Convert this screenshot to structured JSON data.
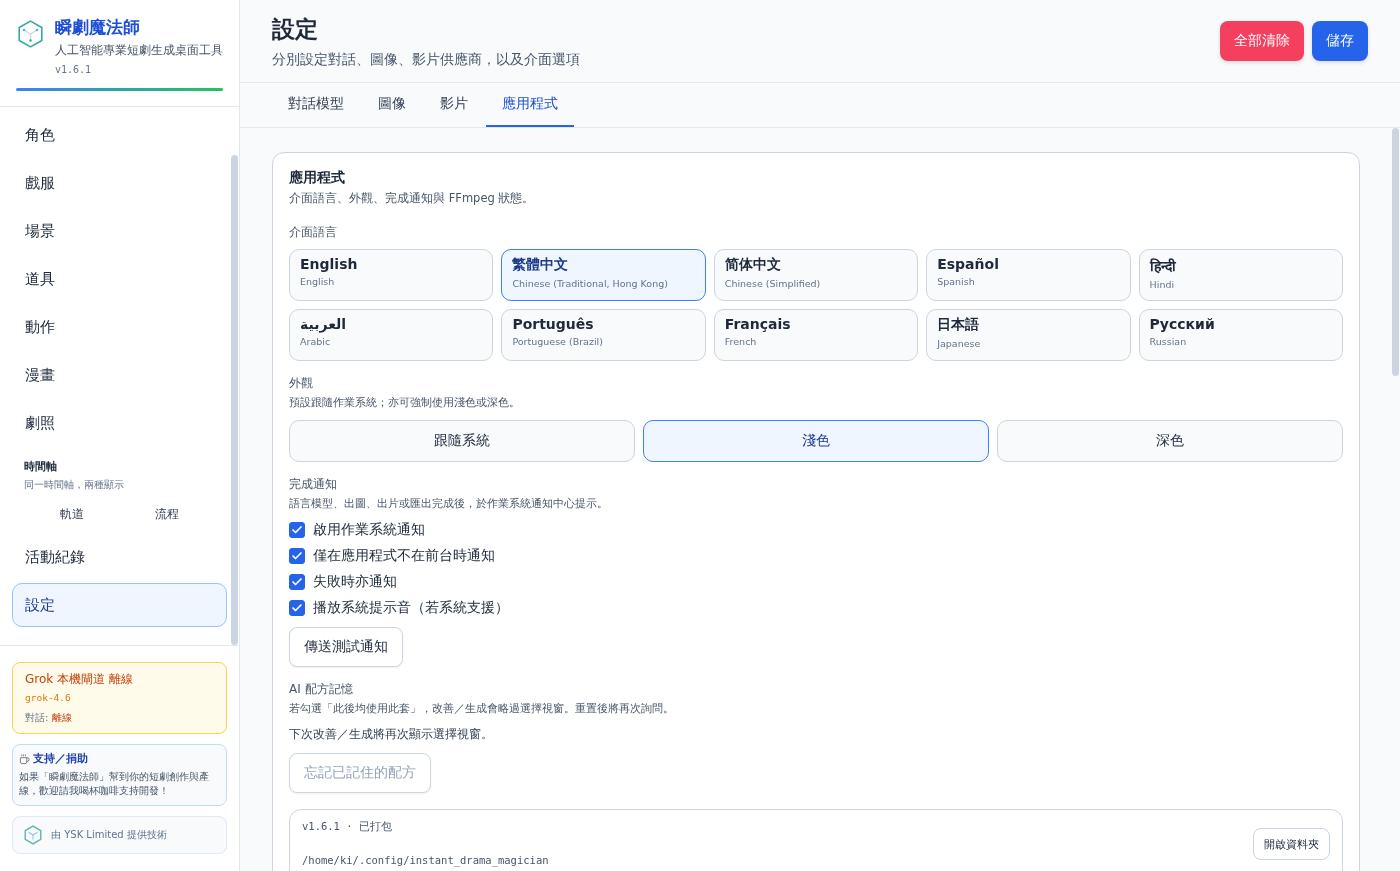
{
  "app": {
    "name": "瞬劇魔法師",
    "tagline": "人工智能專業短劇生成桌面工具",
    "version": "v1.6.1"
  },
  "nav": [
    {
      "kind": "link",
      "label": "角色",
      "selected": false
    },
    {
      "kind": "link",
      "label": "戲服",
      "selected": false
    },
    {
      "kind": "link",
      "label": "場景",
      "selected": false
    },
    {
      "kind": "link",
      "label": "道具",
      "selected": false
    },
    {
      "kind": "link",
      "label": "動作",
      "selected": false
    },
    {
      "kind": "link",
      "label": "漫畫",
      "selected": false
    },
    {
      "kind": "link",
      "label": "劇照",
      "selected": false
    },
    {
      "kind": "group",
      "title": "時間軸",
      "subtitle": "同一時間軸，兩種顯示",
      "children": [
        {
          "label": "軌道",
          "selected": false
        },
        {
          "label": "流程",
          "selected": false
        }
      ]
    },
    {
      "kind": "link",
      "label": "活動紀錄",
      "selected": false
    },
    {
      "kind": "link",
      "label": "設定",
      "selected": true
    }
  ],
  "status_card": {
    "title": "Grok 本機閘道 離線",
    "model": "grok-4.6",
    "label": "對話:",
    "value": "離線"
  },
  "support": {
    "title": "支持／捐助",
    "text": "如果「瞬劇魔法師」幫到你的短劇創作與產線，歡迎請我喝杯咖啡支持開發！"
  },
  "credit": "由 YSK Limited 提供技術",
  "header": {
    "title": "設定",
    "subtitle": "分別設定對話、圖像、影片供應商，以及介面選項"
  },
  "actions": [
    {
      "label": "全部清除",
      "kind": "danger"
    },
    {
      "label": "儲存",
      "kind": "primary"
    }
  ],
  "tabs": [
    {
      "label": "對話模型",
      "selected": false
    },
    {
      "label": "圖像",
      "selected": false
    },
    {
      "label": "影片",
      "selected": false
    },
    {
      "label": "應用程式",
      "selected": true
    }
  ],
  "section": {
    "title": "應用程式",
    "subtitle": "介面語言、外觀、完成通知與 FFmpeg 狀態。",
    "language": {
      "label": "介面語言",
      "options": [
        {
          "name": "English",
          "sub": "English",
          "selected": false
        },
        {
          "name": "繁體中文",
          "sub": "Chinese (Traditional, Hong Kong)",
          "selected": true
        },
        {
          "name": "简体中文",
          "sub": "Chinese (Simplified)",
          "selected": false
        },
        {
          "name": "Español",
          "sub": "Spanish",
          "selected": false
        },
        {
          "name": "हिन्दी",
          "sub": "Hindi",
          "selected": false
        },
        {
          "name": "العربية",
          "sub": "Arabic",
          "selected": false
        },
        {
          "name": "Português",
          "sub": "Portuguese (Brazil)",
          "selected": false
        },
        {
          "name": "Français",
          "sub": "French",
          "selected": false
        },
        {
          "name": "日本語",
          "sub": "Japanese",
          "selected": false
        },
        {
          "name": "Русский",
          "sub": "Russian",
          "selected": false
        }
      ]
    },
    "appearance": {
      "label": "外觀",
      "hint": "預設跟隨作業系統；亦可強制使用淺色或深色。",
      "options": [
        {
          "label": "跟隨系統",
          "selected": false
        },
        {
          "label": "淺色",
          "selected": true
        },
        {
          "label": "深色",
          "selected": false
        }
      ]
    },
    "notifications": {
      "label": "完成通知",
      "hint": "語言模型、出圖、出片或匯出完成後，於作業系統通知中心提示。",
      "options": [
        {
          "label": "啟用作業系統通知",
          "checked": true
        },
        {
          "label": "僅在應用程式不在前台時通知",
          "checked": true
        },
        {
          "label": "失敗時亦通知",
          "checked": true
        },
        {
          "label": "播放系統提示音（若系統支援）",
          "checked": true
        }
      ],
      "button": "傳送測試通知"
    },
    "memory": {
      "label": "AI 配方記憶",
      "hint": "若勾選「此後均使用此套」，改善／生成會略過選擇視窗。重置後將再次詢問。",
      "status": "下次改善／生成將再次顯示選擇視窗。",
      "button": "忘記已記住的配方",
      "button_disabled": true
    },
    "build": {
      "version": "v1.6.1 · 已打包",
      "path": "/home/ki/.config/instant_drama_magician",
      "button": "開啟資料夾"
    }
  }
}
